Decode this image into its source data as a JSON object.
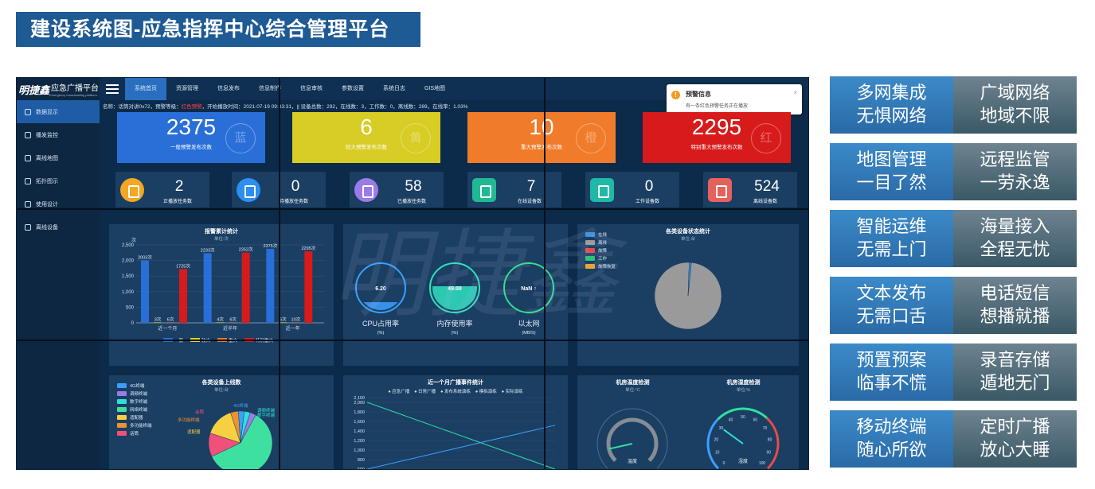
{
  "banner": {
    "title": "建设系统图-应急指挥中心综合管理平台"
  },
  "app": {
    "logo_mark": "明捷鑫",
    "logo_title": "应急广播平台",
    "logo_sub": "Emergency broadcasting platform"
  },
  "sidebar": {
    "items": [
      {
        "label": "数据显示",
        "icon": "chart-icon",
        "active": true
      },
      {
        "label": "播发监控",
        "icon": "headset-icon"
      },
      {
        "label": "离线地图",
        "icon": "location-icon"
      },
      {
        "label": "拓扑图示",
        "icon": "folder-icon"
      },
      {
        "label": "使用设计",
        "icon": "clock-icon"
      },
      {
        "label": "离线设备",
        "icon": "database-icon"
      }
    ]
  },
  "topbar": {
    "tabs": [
      {
        "label": "系统首页",
        "active": true
      },
      {
        "label": "资源管理"
      },
      {
        "label": "信息发布"
      },
      {
        "label": "信息制作"
      },
      {
        "label": "信息审核"
      },
      {
        "label": "参数设置"
      },
      {
        "label": "系统日志"
      },
      {
        "label": "GIS地图"
      }
    ]
  },
  "notice": {
    "title": "预警信息",
    "body": "有一条红色预警任务正在播放",
    "close": "×"
  },
  "status": {
    "prefix": "名称：话筒对讲0x72，预警等级：",
    "level": "红色预警",
    "suffix": "，开始播放时间：2021-07-19 09:43:31，|| 设备总数：292，在线数：3，工作数：0，离线数：289，在线率：1.03%"
  },
  "big_cards": [
    {
      "value": "2375",
      "label": "一般预警发布次数",
      "stamp": "蓝",
      "color": "#2a6fd8"
    },
    {
      "value": "6",
      "label": "较大预警发布次数",
      "stamp": "黄",
      "color": "#d7cd24"
    },
    {
      "value": "10",
      "label": "重大预警发布次数",
      "stamp": "橙",
      "color": "#f07c2b"
    },
    {
      "value": "2295",
      "label": "特别重大预警发布次数",
      "stamp": "红",
      "color": "#d71b1b"
    }
  ],
  "small_cards": [
    {
      "value": "2",
      "label": "正播放任务数",
      "icon": "play-icon",
      "color": "#f5a623"
    },
    {
      "value": "0",
      "label": "待播放任务数",
      "icon": "hourglass-icon",
      "color": "#2d8ff0"
    },
    {
      "value": "58",
      "label": "已播放任务数",
      "icon": "clipboard-icon",
      "color": "#9b7be8"
    },
    {
      "value": "7",
      "label": "在线设备数",
      "icon": "monitor-icon",
      "color": "#20b994"
    },
    {
      "value": "0",
      "label": "工作设备数",
      "icon": "screen-check-icon",
      "color": "#20b9a8"
    },
    {
      "value": "524",
      "label": "离线设备数",
      "icon": "screen-x-icon",
      "color": "#e5625c"
    }
  ],
  "panels": {
    "alarm_stats": {
      "title": "报警累计统计",
      "unit": "单位:次",
      "y_label": "次"
    },
    "gauges": [
      {
        "value": "6.20",
        "label": "CPU占用率",
        "unit": "(%)",
        "color": "#3aa0ff"
      },
      {
        "value": "49.00",
        "label": "内存使用率",
        "unit": "(%)",
        "color": "#2ee0c0"
      },
      {
        "value": "NaN ↑",
        "label": "以太网",
        "unit": "(MB/S)",
        "color": "#2ee08a"
      }
    ],
    "device_status": {
      "title": "各类设备状态统计",
      "unit": "单位:台",
      "legend": [
        {
          "label": "在线",
          "color": "#3a8fe0"
        },
        {
          "label": "离线",
          "color": "#9a9a9a"
        },
        {
          "label": "故障",
          "color": "#e84a4a"
        },
        {
          "label": "工作",
          "color": "#2ec27a"
        },
        {
          "label": "故障恢复",
          "color": "#f0a020"
        }
      ]
    },
    "device_online": {
      "title": "各类设备上线数",
      "unit": "单位:台",
      "legend": [
        {
          "label": "4G终端",
          "color": "#3aa0ff"
        },
        {
          "label": "调频终端",
          "color": "#9b7be8"
        },
        {
          "label": "数字终端",
          "color": "#2ee0d8"
        },
        {
          "label": "网络终端",
          "color": "#3ee0a0"
        },
        {
          "label": "适配器",
          "color": "#f5d040"
        },
        {
          "label": "多功能终端",
          "color": "#f09030"
        },
        {
          "label": "话筒",
          "color": "#f0507a"
        }
      ],
      "slice_labels": [
        "4G终端",
        "调频终端",
        "数字终端",
        "话筒",
        "多功能终端",
        "适配器"
      ]
    },
    "event_stats": {
      "title": "近一个月广播事件统计",
      "legend": [
        "应急广播",
        "日常广播",
        "发布系统演练",
        "模拟演练",
        "实际演练"
      ]
    },
    "room_temp": {
      "title": "机房温度检测",
      "unit": "单位:°C",
      "label": "温度"
    },
    "room_humid": {
      "title": "机房湿度检测",
      "unit": "单位:%",
      "label": "湿度"
    }
  },
  "chart_data": [
    {
      "type": "bar",
      "title": "报警累计统计",
      "ylabel": "次",
      "categories": [
        "近一个月",
        "近半年",
        "近一年"
      ],
      "ylim": [
        0,
        2500
      ],
      "series": [
        {
          "name": "一般",
          "color": "#2a6fd8",
          "values": [
            2003,
            2233,
            2375
          ],
          "labels": [
            "2003次",
            "2233次",
            "2375次"
          ]
        },
        {
          "name": "较大",
          "color": "#e0d020",
          "values": [
            3,
            4,
            6
          ],
          "labels": [
            "3次",
            "4次",
            "6次"
          ]
        },
        {
          "name": "重大",
          "color": "#f07c2b",
          "values": [
            6,
            6,
            10
          ],
          "labels": [
            "6次",
            "6次",
            "10次"
          ]
        },
        {
          "name": "特别重大",
          "color": "#d71b1b",
          "values": [
            1725,
            2252,
            2295
          ],
          "labels": [
            "1725次",
            "2252次",
            "2295次"
          ]
        }
      ],
      "y_ticks": [
        "0",
        "500",
        "1,000",
        "1,500",
        "2,000",
        "2,500"
      ]
    },
    {
      "type": "pie",
      "title": "各类设备状态统计",
      "slices": [
        {
          "name": "离线",
          "value": 289,
          "color": "#9a9a9a"
        },
        {
          "name": "在线",
          "value": 3,
          "color": "#3a8fe0"
        }
      ]
    },
    {
      "type": "pie",
      "title": "各类设备上线数",
      "slices": [
        {
          "name": "网络终端",
          "value": 60,
          "color": "#3ee0a0"
        },
        {
          "name": "话筒",
          "value": 12,
          "color": "#f0507a"
        },
        {
          "name": "适配器",
          "value": 15,
          "color": "#f5d040"
        },
        {
          "name": "多功能终端",
          "value": 4,
          "color": "#f09030"
        },
        {
          "name": "4G终端",
          "value": 3,
          "color": "#3aa0ff"
        },
        {
          "name": "数字终端",
          "value": 3,
          "color": "#2ee0d8"
        },
        {
          "name": "调频终端",
          "value": 3,
          "color": "#9b7be8"
        }
      ]
    },
    {
      "type": "line",
      "title": "近一个月广播事件统计",
      "y_ticks": [
        "600",
        "800",
        "1,000",
        "1,200",
        "1,400",
        "1,600",
        "1,800",
        "2,000",
        "2,100"
      ],
      "ylim": [
        600,
        2100
      ],
      "series": [
        {
          "name": "日常广播",
          "color": "#2ee0a0",
          "values": [
            2000,
            600
          ]
        },
        {
          "name": "发布系统演练",
          "color": "#3aa0ff",
          "values": [
            600,
            1520
          ]
        }
      ]
    }
  ],
  "features": [
    {
      "left": [
        "多网集成",
        "无惧网络"
      ],
      "right": [
        "广域网络",
        "地域不限"
      ]
    },
    {
      "left": [
        "地图管理",
        "一目了然"
      ],
      "right": [
        "远程监管",
        "一劳永逸"
      ]
    },
    {
      "left": [
        "智能运维",
        "无需上门"
      ],
      "right": [
        "海量接入",
        "全程无忧"
      ]
    },
    {
      "left": [
        "文本发布",
        "无需口舌"
      ],
      "right": [
        "电话短信",
        "想播就播"
      ]
    },
    {
      "left": [
        "预置预案",
        "临事不慌"
      ],
      "right": [
        "录音存储",
        "遁地无门"
      ]
    },
    {
      "left": [
        "移动终端",
        "随心所欲"
      ],
      "right": [
        "定时广播",
        "放心大睡"
      ]
    }
  ],
  "watermark": "明捷鑫"
}
